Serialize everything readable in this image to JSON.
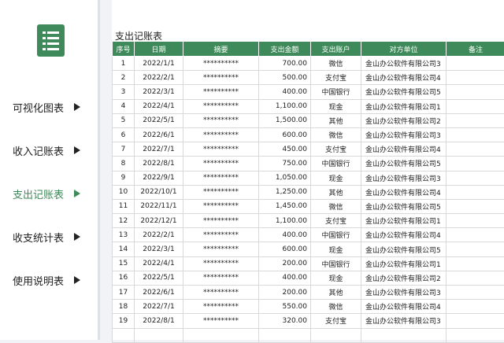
{
  "sidebar": {
    "logo_icon": "list-icon",
    "items": [
      {
        "label": "可视化图表",
        "active": false
      },
      {
        "label": "收入记账表",
        "active": false
      },
      {
        "label": "支出记账表",
        "active": true
      },
      {
        "label": "收支统计表",
        "active": false
      },
      {
        "label": "使用说明表",
        "active": false
      }
    ],
    "accent_color": "#3f8a5a"
  },
  "sheet": {
    "title": "支出记账表",
    "columns": [
      "序号",
      "日期",
      "摘要",
      "支出金额",
      "支出账户",
      "对方单位",
      "备注"
    ],
    "rows": [
      [
        "1",
        "2022/1/1",
        "**********",
        "700.00",
        "微信",
        "金山办公软件有限公司3",
        ""
      ],
      [
        "2",
        "2022/2/1",
        "**********",
        "500.00",
        "支付宝",
        "金山办公软件有限公司4",
        ""
      ],
      [
        "3",
        "2022/3/1",
        "**********",
        "400.00",
        "中国银行",
        "金山办公软件有限公司5",
        ""
      ],
      [
        "4",
        "2022/4/1",
        "**********",
        "1,100.00",
        "现金",
        "金山办公软件有限公司1",
        ""
      ],
      [
        "5",
        "2022/5/1",
        "**********",
        "1,500.00",
        "其他",
        "金山办公软件有限公司2",
        ""
      ],
      [
        "6",
        "2022/6/1",
        "**********",
        "600.00",
        "微信",
        "金山办公软件有限公司3",
        ""
      ],
      [
        "7",
        "2022/7/1",
        "**********",
        "450.00",
        "支付宝",
        "金山办公软件有限公司4",
        ""
      ],
      [
        "8",
        "2022/8/1",
        "**********",
        "750.00",
        "中国银行",
        "金山办公软件有限公司5",
        ""
      ],
      [
        "9",
        "2022/9/1",
        "**********",
        "1,050.00",
        "现金",
        "金山办公软件有限公司3",
        ""
      ],
      [
        "10",
        "2022/10/1",
        "**********",
        "1,250.00",
        "其他",
        "金山办公软件有限公司4",
        ""
      ],
      [
        "11",
        "2022/11/1",
        "**********",
        "1,450.00",
        "微信",
        "金山办公软件有限公司5",
        ""
      ],
      [
        "12",
        "2022/12/1",
        "**********",
        "1,100.00",
        "支付宝",
        "金山办公软件有限公司1",
        ""
      ],
      [
        "13",
        "2022/2/1",
        "**********",
        "400.00",
        "中国银行",
        "金山办公软件有限公司4",
        ""
      ],
      [
        "14",
        "2022/3/1",
        "**********",
        "600.00",
        "现金",
        "金山办公软件有限公司5",
        ""
      ],
      [
        "15",
        "2022/4/1",
        "**********",
        "200.00",
        "中国银行",
        "金山办公软件有限公司1",
        ""
      ],
      [
        "16",
        "2022/5/1",
        "**********",
        "400.00",
        "现金",
        "金山办公软件有限公司2",
        ""
      ],
      [
        "17",
        "2022/6/1",
        "**********",
        "200.00",
        "其他",
        "金山办公软件有限公司3",
        ""
      ],
      [
        "18",
        "2022/7/1",
        "**********",
        "550.00",
        "微信",
        "金山办公软件有限公司4",
        ""
      ],
      [
        "19",
        "2022/8/1",
        "**********",
        "320.00",
        "支付宝",
        "金山办公软件有限公司3",
        ""
      ],
      [
        "",
        "",
        "",
        "",
        "",
        "",
        ""
      ]
    ],
    "header_color": "#3f8a5a"
  }
}
